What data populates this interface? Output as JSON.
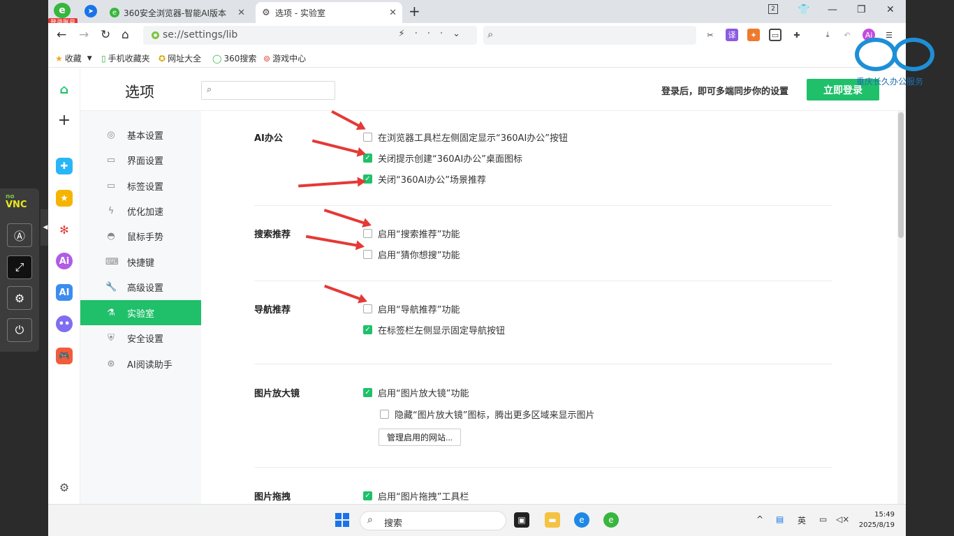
{
  "novnc": {
    "logo_top": "no",
    "logo_main": "VNC"
  },
  "browser": {
    "login_badge": "登录账号",
    "tabs": [
      {
        "title": "360安全浏览器-智能AI版本"
      },
      {
        "title": "选项 - 实验室"
      }
    ],
    "tab_count": "2",
    "address": {
      "url": "se://settings/lib"
    },
    "bookmarks": [
      "收藏",
      "手机收藏夹",
      "网址大全",
      "360搜索",
      "游戏中心"
    ]
  },
  "settings": {
    "title": "选项",
    "login_hint": "登录后，即可多端同步你的设置",
    "login_button": "立即登录",
    "menu": [
      {
        "label": "基本设置",
        "icon": "gear-outline-icon"
      },
      {
        "label": "界面设置",
        "icon": "window-icon"
      },
      {
        "label": "标签设置",
        "icon": "tab-icon"
      },
      {
        "label": "优化加速",
        "icon": "lightning-icon"
      },
      {
        "label": "鼠标手势",
        "icon": "mouse-icon"
      },
      {
        "label": "快捷键",
        "icon": "keyboard-icon"
      },
      {
        "label": "高级设置",
        "icon": "wrench-icon"
      },
      {
        "label": "实验室",
        "icon": "flask-icon",
        "active": true
      },
      {
        "label": "安全设置",
        "icon": "shield-icon"
      },
      {
        "label": "AI阅读助手",
        "icon": "ai-reader-icon"
      }
    ],
    "sections": {
      "ai_office": {
        "title": "AI办公",
        "options": [
          {
            "label": "在浏览器工具栏左侧固定显示“360AI办公”按钮",
            "checked": false
          },
          {
            "label": "关闭提示创建“360AI办公”桌面图标",
            "checked": true
          },
          {
            "label": "关闭“360AI办公”场景推荐",
            "checked": true
          }
        ]
      },
      "search": {
        "title": "搜索推荐",
        "options": [
          {
            "label": "启用“搜索推荐”功能",
            "checked": false
          },
          {
            "label": "启用“猜你想搜”功能",
            "checked": false
          }
        ]
      },
      "nav": {
        "title": "导航推荐",
        "options": [
          {
            "label": "启用“导航推荐”功能",
            "checked": false
          },
          {
            "label": "在标签栏左侧显示固定导航按钮",
            "checked": true
          }
        ]
      },
      "magnifier": {
        "title": "图片放大镜",
        "options": [
          {
            "label": "启用“图片放大镜”功能",
            "checked": true
          },
          {
            "label": "隐藏“图片放大镜”图标，腾出更多区域来显示图片",
            "checked": false
          }
        ],
        "manage_button": "管理启用的网站..."
      },
      "drag": {
        "title": "图片拖拽",
        "options": [
          {
            "label": "启用“图片拖拽”工具栏",
            "checked": true
          }
        ]
      }
    }
  },
  "taskbar": {
    "search_label": "搜索",
    "ime": "英",
    "time": "15:49",
    "date": "2025/8/19"
  },
  "watermark": {
    "text": "重庆长久办公服务"
  },
  "colors": {
    "accent": "#20c06a",
    "arrow": "#e53935",
    "tab_bg": "#dfe3e8"
  }
}
